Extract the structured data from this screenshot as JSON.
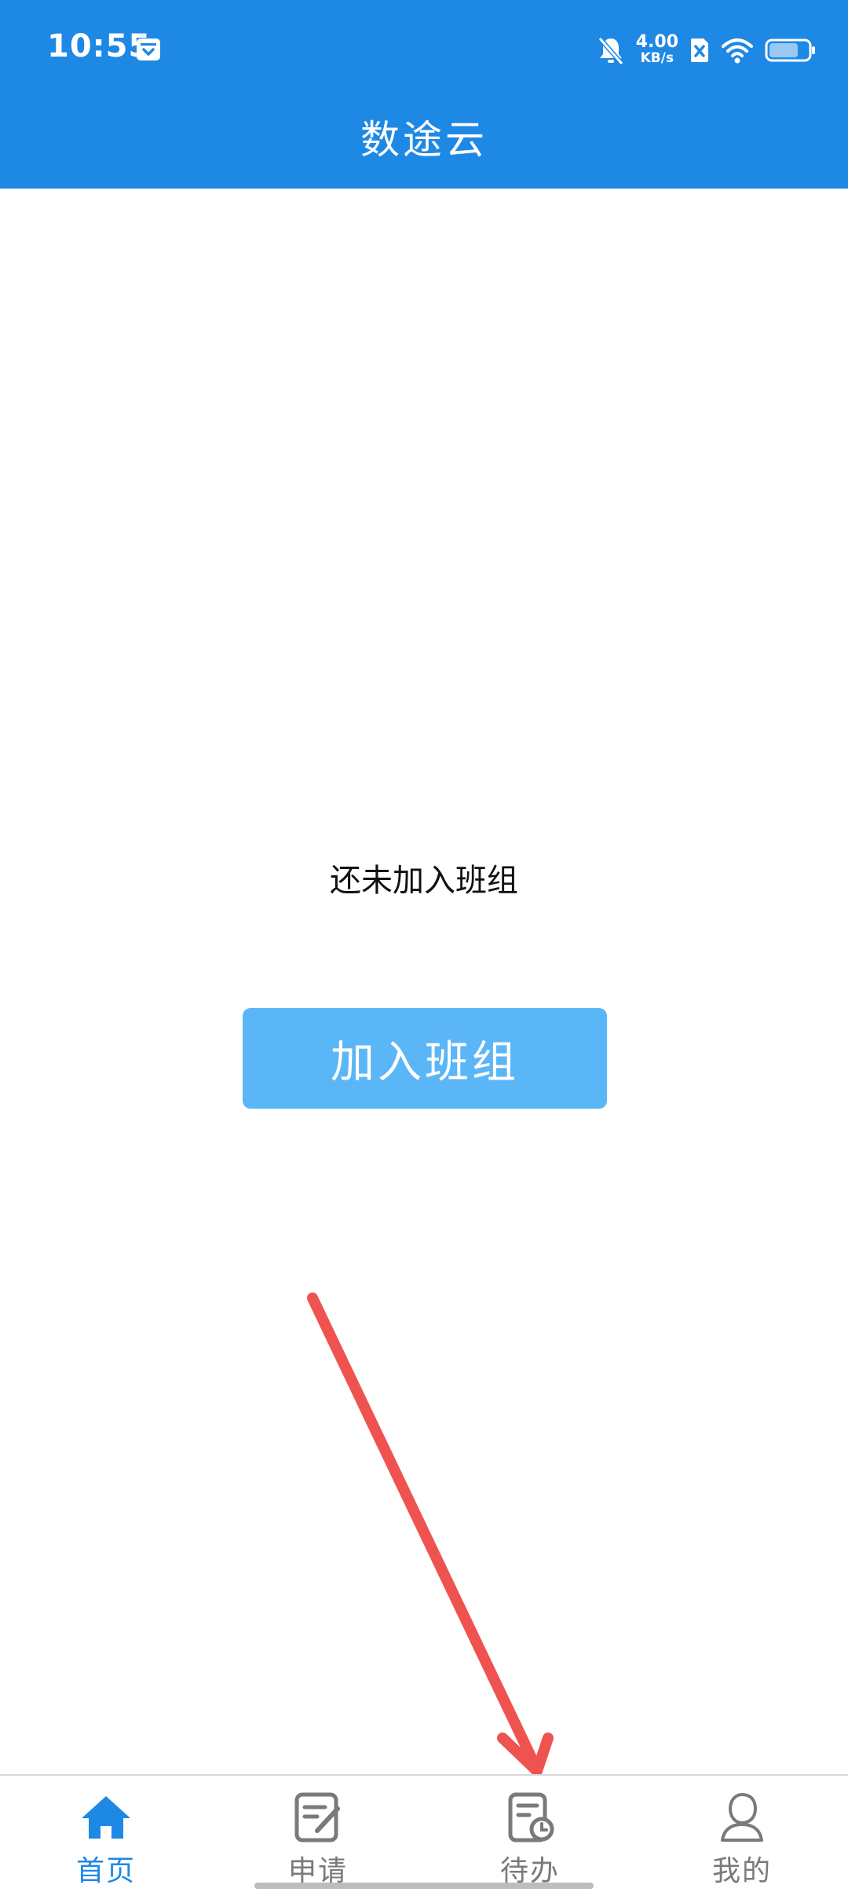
{
  "status_bar": {
    "time": "10:55",
    "net_speed_value": "4.00",
    "net_speed_unit": "KB/s",
    "battery_level": 0.75
  },
  "app_bar": {
    "title": "数途云"
  },
  "main": {
    "empty_message": "还未加入班组",
    "join_button_label": "加入班组"
  },
  "bottom_nav": {
    "items": [
      {
        "label": "首页",
        "icon": "home-icon",
        "active": true
      },
      {
        "label": "申请",
        "icon": "edit-form-icon",
        "active": false
      },
      {
        "label": "待办",
        "icon": "todo-clock-icon",
        "active": false
      },
      {
        "label": "我的",
        "icon": "user-icon",
        "active": false
      }
    ]
  },
  "colors": {
    "primary": "#1e88e5",
    "button": "#5bb6f8",
    "annotation_arrow": "#ef5350",
    "nav_inactive": "#7a7a7a"
  }
}
